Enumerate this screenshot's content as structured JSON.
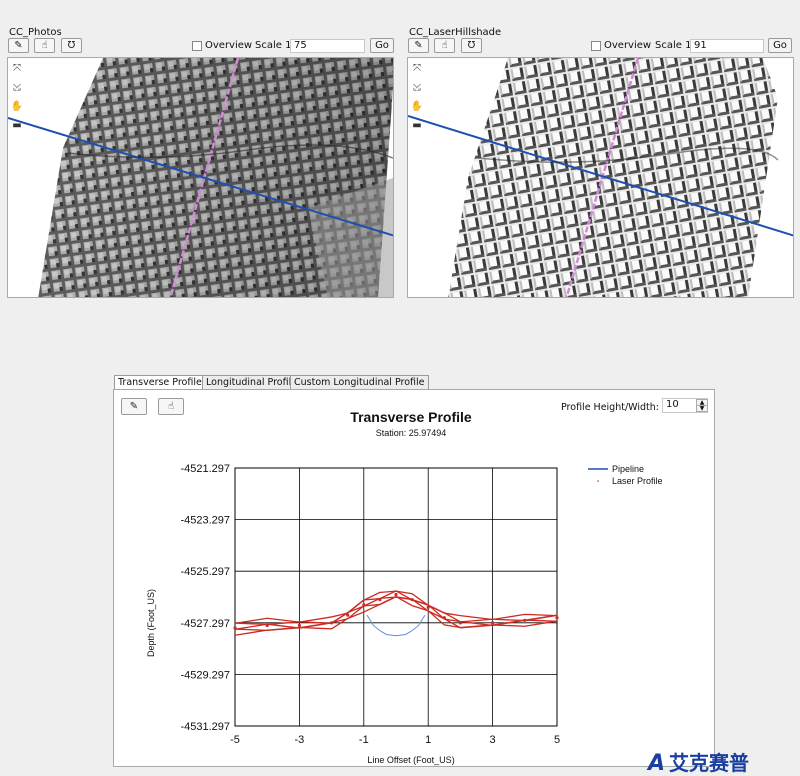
{
  "left_panel": {
    "title": "CC_Photos",
    "overview_label": "Overview",
    "scale_label": "Scale 1:",
    "scale_value": "75",
    "go_label": "Go"
  },
  "right_panel": {
    "title": "CC_LaserHillshade",
    "overview_label": "Overview",
    "scale_label": "Scale 1:",
    "scale_value": "91",
    "go_label": "Go"
  },
  "tabs": [
    {
      "label": "Transverse Profile",
      "active": true
    },
    {
      "label": "Longitudinal Profile",
      "active": false
    },
    {
      "label": "Custom Longitudinal Profile",
      "active": false
    }
  ],
  "profile": {
    "height_width_label": "Profile Height/Width:",
    "height_width_value": "10"
  },
  "colors": {
    "pipeline": "#1f4fb0",
    "laser": "#cc2a22",
    "centerline": "#c86ad2"
  },
  "watermark": {
    "text": "艾克赛普"
  },
  "chart_data": {
    "type": "line",
    "title": "Transverse Profile",
    "subtitle": "Station: 25.97494",
    "xlabel": "Line Offset (Foot_US)",
    "ylabel": "Depth (Foot_US)",
    "xlim": [
      -5,
      5
    ],
    "ylim": [
      -4531.297,
      -4521.297
    ],
    "x_ticks": [
      "-5",
      "-3",
      "-1",
      "1",
      "3",
      "5"
    ],
    "y_ticks": [
      "-4521.297",
      "-4523.297",
      "-4525.297",
      "-4527.297",
      "-4529.297",
      "-4531.297"
    ],
    "grid": true,
    "legend_position": "right",
    "series": [
      {
        "name": "Pipeline",
        "style": "arc",
        "x": [
          -0.9,
          -0.7,
          -0.5,
          -0.3,
          0,
          0.3,
          0.5,
          0.7,
          0.9
        ],
        "y": [
          -4527.0,
          -4527.4,
          -4527.6,
          -4527.75,
          -4527.8,
          -4527.75,
          -4527.6,
          -4527.4,
          -4527.0
        ]
      },
      {
        "name": "Laser Profile",
        "style": "scatter-bands",
        "x": [
          -5.0,
          -4.0,
          -3.0,
          -2.0,
          -1.5,
          -1.0,
          -0.5,
          0.0,
          0.5,
          1.0,
          1.5,
          2.0,
          3.0,
          4.0,
          5.0
        ],
        "y": [
          -4527.5,
          -4527.4,
          -4527.4,
          -4527.3,
          -4527.0,
          -4526.6,
          -4526.4,
          -4526.2,
          -4526.4,
          -4526.7,
          -4527.1,
          -4527.3,
          -4527.3,
          -4527.2,
          -4527.1
        ]
      }
    ]
  }
}
